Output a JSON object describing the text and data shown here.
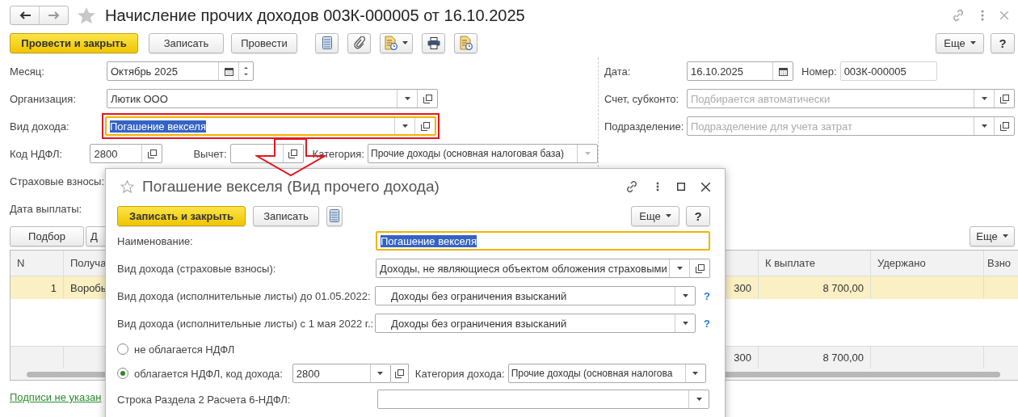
{
  "window": {
    "title": "Начисление прочих доходов 003К-000005 от 16.10.2025"
  },
  "toolbar": {
    "primary": "Провести и закрыть",
    "buttons": [
      "Записать",
      "Провести"
    ],
    "more": "Еще",
    "help": "?"
  },
  "form": {
    "month": {
      "label": "Месяц:",
      "value": "Октябрь 2025"
    },
    "organization": {
      "label": "Организация:",
      "value": "Лютик ООО"
    },
    "income_type": {
      "label": "Вид дохода:",
      "value": "Погашение векселя",
      "focused": true,
      "highlighted": true
    },
    "ndfl_code": {
      "label": "Код НДФЛ:",
      "value": "2800"
    },
    "deduction": {
      "label": "Вычет:"
    },
    "category": {
      "label": "Категория:",
      "value": "Прочие доходы (основная налоговая база)",
      "disabled": true
    },
    "insurance_label": "Страховые взносы:",
    "payment_date_label": "Дата выплаты:",
    "date": {
      "label": "Дата:",
      "value": "16.10.2025"
    },
    "number": {
      "label": "Номер:",
      "value": "003К-000005"
    },
    "account": {
      "label": "Счет, субконто:",
      "placeholder": "Подбирается автоматически"
    },
    "department": {
      "label": "Подразделение:",
      "placeholder": "Подразделение для учета затрат"
    }
  },
  "table_toolbar": {
    "buttons": [
      "Подбор",
      "Д"
    ],
    "more": "Еще"
  },
  "table": {
    "columns": [
      "N",
      "Получа",
      "К выплате",
      "Удержано",
      "Взно"
    ],
    "rows": [
      {
        "n": "1",
        "column_2": "Воробь",
        "column_3": "300",
        "to_pay": "8 700,00",
        "selected": true
      }
    ],
    "footer": {
      "column_3": "300",
      "to_pay": "8 700,00"
    }
  },
  "signatures_link": "Подписи не указан",
  "dialog": {
    "title": "Погашение векселя (Вид прочего дохода)",
    "primary": "Записать и закрыть",
    "buttons": [
      "Записать"
    ],
    "more": "Еще",
    "help": "?",
    "name": {
      "label": "Наименование:",
      "value": "Погашение векселя",
      "focused": true
    },
    "insurance_type": {
      "label": "Вид дохода (страховые взносы):",
      "value": "Доходы, не являющиеся объектом обложения страховыми"
    },
    "writ_types": [
      {
        "label": "Вид дохода (исполнительные листы) до 01.05.2022:",
        "value": "Доходы без ограничения взысканий",
        "help": "?"
      },
      {
        "label": "Вид дохода (исполнительные листы) с 1 мая 2022 г.:",
        "value": "Доходы без ограничения взысканий",
        "help": "?"
      }
    ],
    "ndfl_options": [
      {
        "label": "не облагается НДФЛ",
        "selected": false
      },
      {
        "label": "облагается НДФЛ, код дохода:",
        "selected": true
      }
    ],
    "income_code": {
      "value": "2800"
    },
    "income_category": {
      "label": "Категория дохода:",
      "value": "Прочие доходы (основная налогова"
    },
    "report_line": {
      "label": "Строка Раздела 2 Расчета 6-НДФЛ:"
    }
  }
}
